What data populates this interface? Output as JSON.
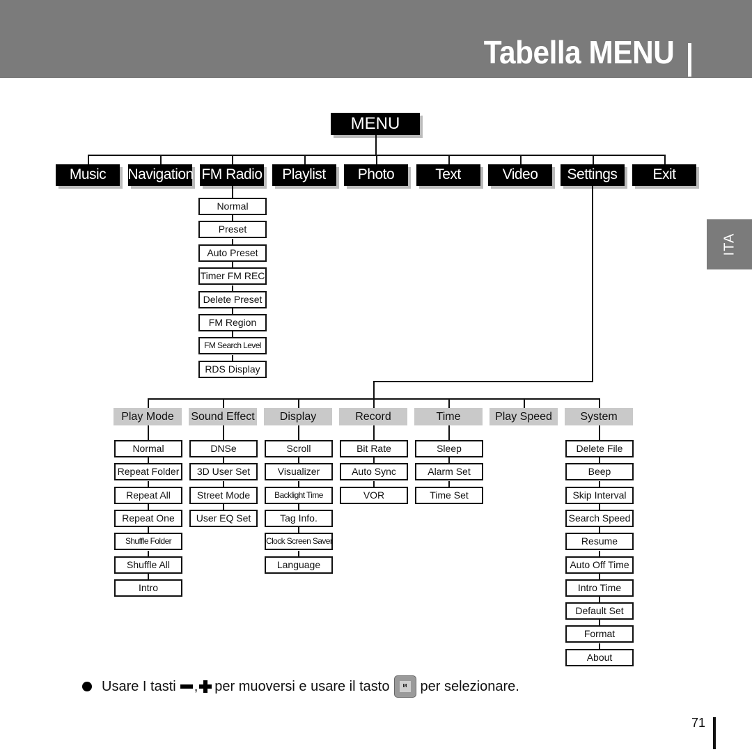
{
  "header": {
    "title": "Tabella MENU"
  },
  "side_tab": "ITA",
  "root": "MENU",
  "top_menu": [
    "Music",
    "Navigation",
    "FM Radio",
    "Playlist",
    "Photo",
    "Text",
    "Video",
    "Settings",
    "Exit"
  ],
  "fm_radio_items": [
    "Normal",
    "Preset",
    "Auto Preset",
    "Timer FM REC",
    "Delete Preset",
    "FM Region",
    "FM Search Level",
    "RDS Display"
  ],
  "settings": [
    {
      "label": "Play Mode",
      "items": [
        "Normal",
        "Repeat Folder",
        "Repeat All",
        "Repeat One",
        "Shuffle Folder",
        "Shuffle All",
        "Intro"
      ]
    },
    {
      "label": "Sound Effect",
      "items": [
        "DNSe",
        "3D User Set",
        "Street Mode",
        "User EQ Set"
      ]
    },
    {
      "label": "Display",
      "items": [
        "Scroll",
        "Visualizer",
        "Backlight Time",
        "Tag Info.",
        "Clock Screen Saver",
        "Language"
      ]
    },
    {
      "label": "Record",
      "items": [
        "Bit Rate",
        "Auto Sync",
        "VOR"
      ]
    },
    {
      "label": "Time",
      "items": [
        "Sleep",
        "Alarm Set",
        "Time Set"
      ]
    },
    {
      "label": "Play Speed",
      "items": []
    },
    {
      "label": "System",
      "items": [
        "Delete File",
        "Beep",
        "Skip Interval",
        "Search Speed",
        "Resume",
        "Auto Off Time",
        "Intro Time",
        "Default Set",
        "Format",
        "About"
      ]
    }
  ],
  "note": {
    "part1": "Usare I tasti",
    "comma": ",",
    "part2": "per muoversi e usare il tasto",
    "key_label": "M",
    "part3": "per selezionare."
  },
  "page_number": "71",
  "colors": {
    "header": "#7b7b7b",
    "subheader": "#c9c9c9",
    "box": "#000000"
  }
}
